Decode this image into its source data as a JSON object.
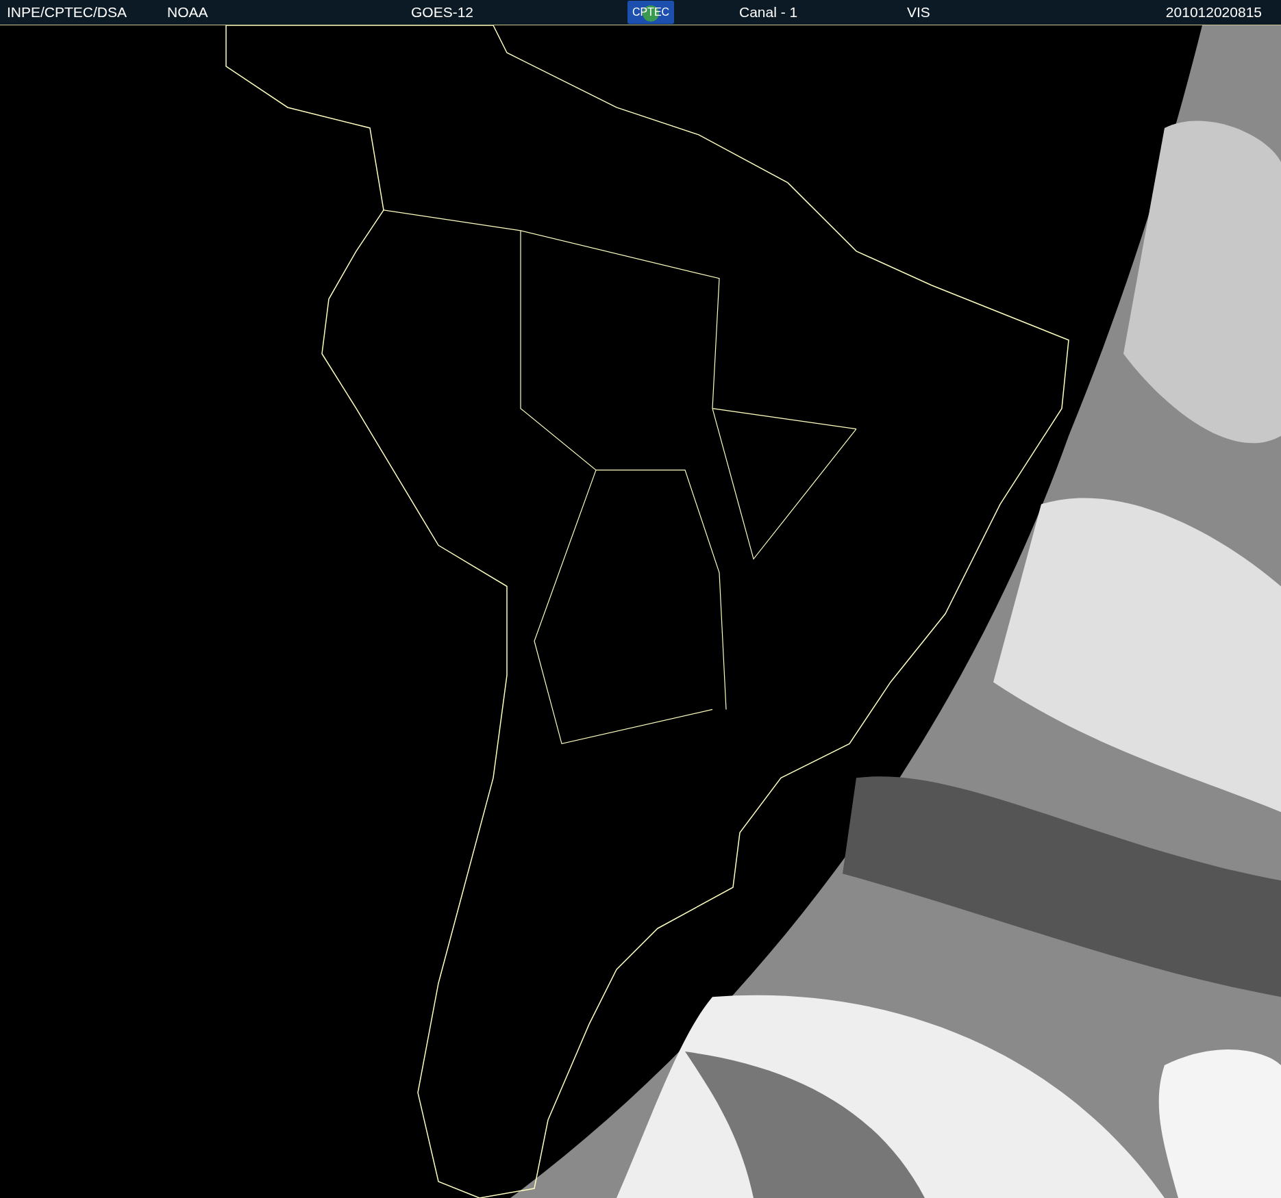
{
  "header": {
    "items": [
      {
        "kind": "text",
        "text": "INPE/CPTEC/DSA"
      },
      {
        "kind": "text",
        "text": "NOAA"
      },
      {
        "kind": "text",
        "text": "GOES-12"
      },
      {
        "kind": "logo",
        "text": "CPTEC"
      },
      {
        "kind": "text",
        "text": "Canal - 1"
      },
      {
        "kind": "text",
        "text": "VIS"
      },
      {
        "kind": "text",
        "text": "201012020815"
      }
    ]
  }
}
